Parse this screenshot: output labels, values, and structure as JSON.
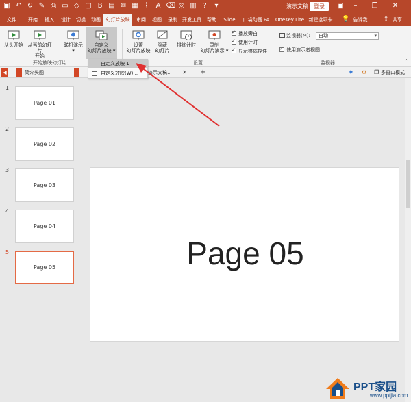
{
  "titlebar": {
    "doc_title": "演示文稿...",
    "login": "登录"
  },
  "tabs": [
    {
      "label": "文件"
    },
    {
      "label": "开始"
    },
    {
      "label": "插入"
    },
    {
      "label": "设计"
    },
    {
      "label": "切换"
    },
    {
      "label": "动画"
    },
    {
      "label": "幻灯片放映"
    },
    {
      "label": "审阅"
    },
    {
      "label": "视图"
    },
    {
      "label": "录制"
    },
    {
      "label": "开发工具"
    },
    {
      "label": "帮助"
    },
    {
      "label": "iSlide"
    },
    {
      "label": "口袋动画 PA"
    },
    {
      "label": "OneKey Lite"
    },
    {
      "label": "新建选项卡"
    },
    {
      "label": "告诉我"
    },
    {
      "label": "共享"
    }
  ],
  "ribbon": {
    "from_start": "从头开始",
    "from_current_1": "从当前幻灯片",
    "from_current_2": "开始",
    "online_1": "联机演示",
    "online_2": "▾",
    "custom_1": "自定义",
    "custom_2": "幻灯片放映 ▾",
    "group_start": "开始放映幻灯片",
    "setup_1": "设置",
    "setup_2": "幻灯片放映",
    "hide_1": "隐藏",
    "hide_2": "幻灯片",
    "rehearse": "排练计时",
    "record_1": "录制",
    "record_2": "幻灯片演示 ▾",
    "chk_narration": "播放旁白",
    "chk_timing": "使用计时",
    "chk_media": "显示媒体控件",
    "group_setup": "设置",
    "monitor_label": "监视器(M):",
    "monitor_value": "自动",
    "chk_presenter": "使用演示者视图",
    "group_monitor": "监视器"
  },
  "docstrip": {
    "tab1": "简介头图",
    "tab2": "演示文稿1",
    "right": "多窗口模式"
  },
  "dropdown": {
    "item1": "自定义放映 1",
    "item2": "自定义放映(W)..."
  },
  "thumbnails": [
    {
      "num": "1",
      "label": "Page 01"
    },
    {
      "num": "2",
      "label": "Page 02"
    },
    {
      "num": "3",
      "label": "Page 03"
    },
    {
      "num": "4",
      "label": "Page 04"
    },
    {
      "num": "5",
      "label": "Page 05"
    }
  ],
  "slide": {
    "title": "Page 05"
  },
  "watermark": {
    "main": "PPT家园",
    "url": "www.pptjia.com"
  },
  "colors": {
    "accent": "#b7472a",
    "selection": "#e46a45",
    "arrow": "#e03030"
  }
}
